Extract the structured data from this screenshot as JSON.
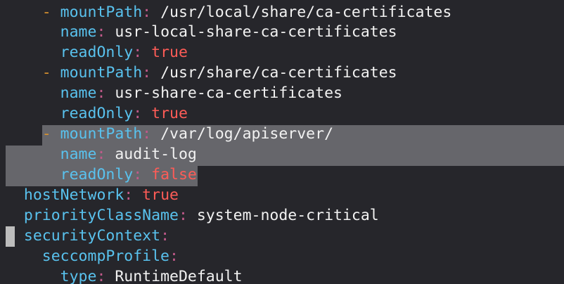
{
  "editor": {
    "lines": [
      {
        "indent": "  ",
        "dash": "- ",
        "key": "mountPath",
        "colon": ":",
        "value": " /usr/local/share/ca-certificates",
        "kind": "str"
      },
      {
        "indent": "    ",
        "dash": "",
        "key": "name",
        "colon": ":",
        "value": " usr-local-share-ca-certificates",
        "kind": "str"
      },
      {
        "indent": "    ",
        "dash": "",
        "key": "readOnly",
        "colon": ":",
        "value": " true",
        "kind": "bool"
      },
      {
        "indent": "  ",
        "dash": "- ",
        "key": "mountPath",
        "colon": ":",
        "value": " /usr/share/ca-certificates",
        "kind": "str"
      },
      {
        "indent": "    ",
        "dash": "",
        "key": "name",
        "colon": ":",
        "value": " usr-share-ca-certificates",
        "kind": "str"
      },
      {
        "indent": "    ",
        "dash": "",
        "key": "readOnly",
        "colon": ":",
        "value": " true",
        "kind": "bool"
      },
      {
        "indent": "  ",
        "dash": "- ",
        "key": "mountPath",
        "colon": ":",
        "value": " /var/log/apiserver/",
        "kind": "str"
      },
      {
        "indent": "    ",
        "dash": "",
        "key": "name",
        "colon": ":",
        "value": " audit-log",
        "kind": "str"
      },
      {
        "indent": "    ",
        "dash": "",
        "key": "readOnly",
        "colon": ":",
        "value": " false",
        "kind": "bool"
      },
      {
        "indent": "",
        "dash": "",
        "key": "hostNetwork",
        "colon": ":",
        "value": " true",
        "kind": "bool"
      },
      {
        "indent": "",
        "dash": "",
        "key": "priorityClassName",
        "colon": ":",
        "value": " system-node-critical",
        "kind": "str"
      },
      {
        "indent": "",
        "dash": "",
        "key": "securityContext",
        "colon": ":",
        "value": "",
        "kind": "str"
      },
      {
        "indent": "  ",
        "dash": "",
        "key": "seccompProfile",
        "colon": ":",
        "value": "",
        "kind": "str"
      },
      {
        "indent": "    ",
        "dash": "",
        "key": "type",
        "colon": ":",
        "value": " RuntimeDefault",
        "kind": "str"
      }
    ],
    "colors": {
      "background": "#26262b",
      "key": "#59c2ee",
      "colon": "#c25a8a",
      "dash": "#d6912f",
      "string": "#f2f2f2",
      "boolean": "#ff5c57",
      "selection": "#66666b",
      "cursor": "#bdbdbd"
    }
  }
}
